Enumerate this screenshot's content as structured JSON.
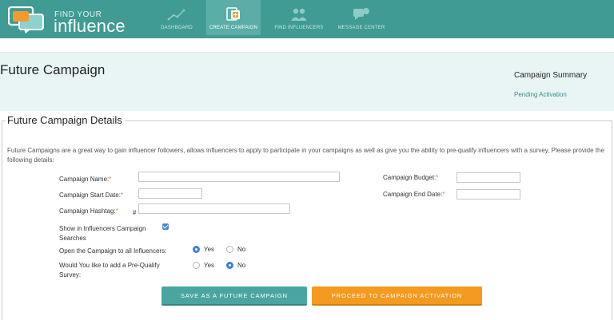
{
  "brand": {
    "find_text": "FIND YOUR",
    "name_text": "influence"
  },
  "nav": {
    "items": [
      {
        "label": "DASHBOARD",
        "icon": "line-chart-icon"
      },
      {
        "label": "CREATE CAMPAIGN",
        "icon": "create-campaign-icon"
      },
      {
        "label": "FIND INFLUENCERS",
        "icon": "people-icon"
      },
      {
        "label": "MESSAGE CENTER",
        "icon": "chat-bubble-icon"
      }
    ],
    "active_index": 1
  },
  "page": {
    "title": "Future Campaign"
  },
  "summary": {
    "title": "Campaign Summary",
    "status": "Pending Activation"
  },
  "details": {
    "legend": "Future Campaign Details",
    "intro": "Future Campaigns are a great way to gain influencer followers, allows influencers to apply to participate in your campaigns as well as give you the ability to pre-qualify influencers with a survey. Please provide the following details:",
    "required_mark": "*",
    "hash_symbol": "#",
    "fields": {
      "campaign_name": {
        "label": "Campaign Name:",
        "value": ""
      },
      "start_date": {
        "label": "Campaign Start Date:",
        "value": ""
      },
      "hashtag": {
        "label": "Campaign Hashtag:",
        "value": ""
      },
      "budget": {
        "label": "Campaign Budget:",
        "value": ""
      },
      "end_date": {
        "label": "Campaign End Date:",
        "value": ""
      }
    },
    "show_in_search": {
      "label_line1": "Show in Influencers Campaign",
      "label_line2": "Searches",
      "checked": true
    },
    "open_to_all": {
      "label": "Open the Campaign to all Influencers:",
      "yes": "Yes",
      "no": "No",
      "selected": "Yes"
    },
    "prequalify": {
      "label_line1": "Would You like to add a Pre-Qualify",
      "label_line2": "Survey:",
      "yes": "Yes",
      "no": "No",
      "selected": "No"
    }
  },
  "buttons": {
    "save": "SAVE AS A FUTURE CAMPAIGN",
    "proceed": "PROCEED TO CAMPAIGN ACTIVATION"
  },
  "colors": {
    "nav_bg": "#3f9b93",
    "accent_teal": "#4aa5a0",
    "accent_orange": "#f39a1f",
    "title_band": "#e9f5f5",
    "required": "#e07a28"
  }
}
